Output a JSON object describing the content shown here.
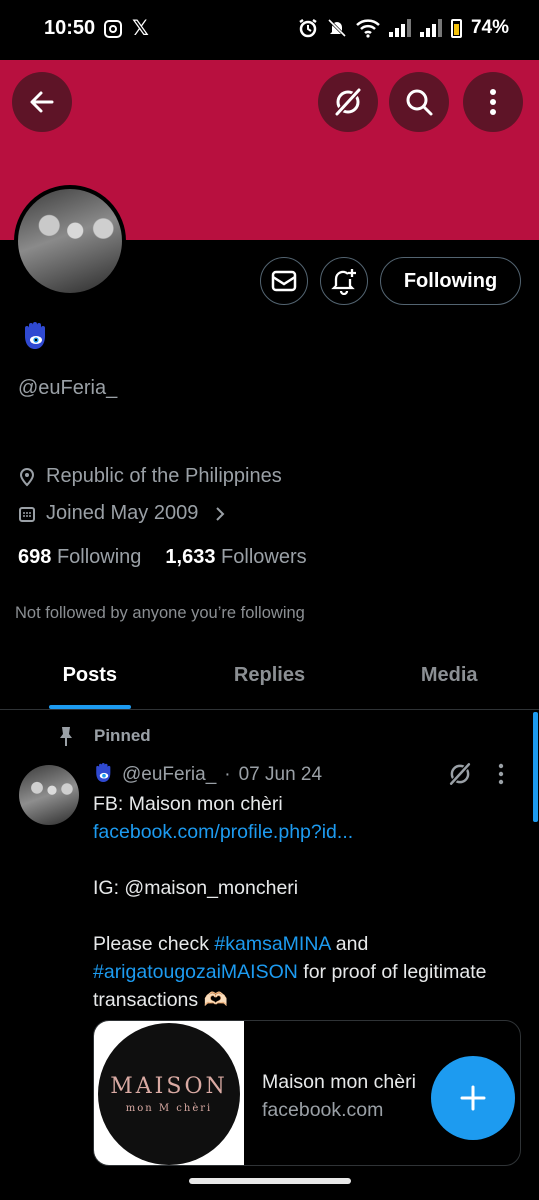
{
  "status_bar": {
    "time": "10:50",
    "x_glyph": "𝕏",
    "battery": "74%"
  },
  "colors": {
    "banner": "#b8103f",
    "accent": "#1d9bf0",
    "background": "#000000"
  },
  "header": {
    "back_icon": "back-arrow-icon",
    "grok_icon": "grok-icon",
    "search_icon": "search-icon",
    "more_icon": "more-vertical-icon"
  },
  "profile": {
    "handle": "@euFeria_",
    "location": "Republic of the Philippines",
    "joined": "Joined May 2009",
    "following_count": "698",
    "following_label": "Following",
    "followers_count": "1,633",
    "followers_label": "Followers",
    "not_followed_text": "Not followed by anyone you’re following",
    "follow_button": "Following"
  },
  "tabs": [
    {
      "label": "Posts",
      "active": true
    },
    {
      "label": "Replies",
      "active": false
    },
    {
      "label": "Media",
      "active": false
    }
  ],
  "post": {
    "pinned_label": "Pinned",
    "author_handle": "@euFeria_",
    "separator": "·",
    "date": "07 Jun 24",
    "line1": "FB: Maison mon chèri",
    "link": "facebook.com/profile.php?id...",
    "line3": "IG: @maison_moncheri",
    "line4_prefix": "Please check ",
    "hashtag1": "#kamsaMINA",
    "line4_mid": " and",
    "hashtag2": "#arigatougozaiMAISON",
    "line5_suffix": " for proof of legitimate transactions 🫶🏻",
    "card": {
      "logo_text": "MAISON",
      "logo_sub": "mon  M  chèri",
      "title": "Maison mon chèri",
      "domain": "facebook.com"
    }
  }
}
